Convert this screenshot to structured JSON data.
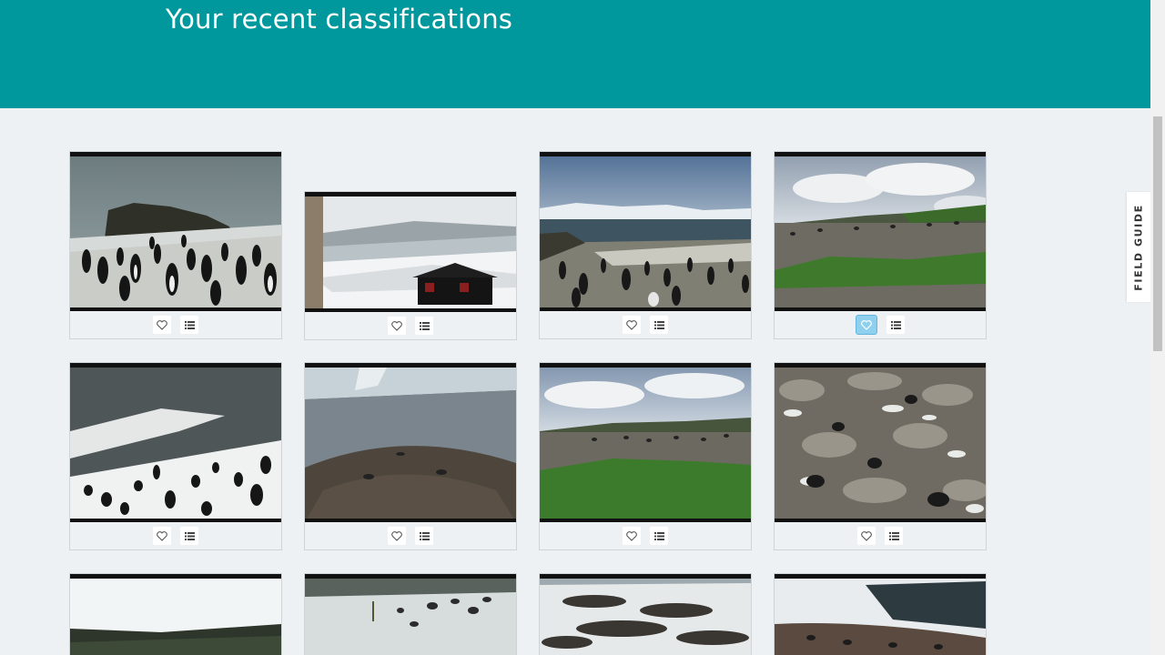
{
  "header": {
    "title": "Your recent classifications",
    "background_color": "#00979d"
  },
  "sidebar_tab": {
    "label": "FIELD GUIDE"
  },
  "icons": {
    "favorite": "heart-icon",
    "collections": "list-icon"
  },
  "colors": {
    "page_background": "#eef1f4",
    "favorite_active": "#8fd0ee"
  },
  "classifications": [
    {
      "favorited": false,
      "scene": "colony-rock"
    },
    {
      "favorited": false,
      "scene": "hut-snow"
    },
    {
      "favorited": false,
      "scene": "colony-sea"
    },
    {
      "favorited": true,
      "scene": "grass-field"
    },
    {
      "favorited": false,
      "scene": "snow-penguins"
    },
    {
      "favorited": false,
      "scene": "rock-dome"
    },
    {
      "favorited": false,
      "scene": "grass-field-2"
    },
    {
      "favorited": false,
      "scene": "rocky-nests"
    },
    {
      "favorited": false,
      "scene": "bright-sky"
    },
    {
      "favorited": false,
      "scene": "snow-field"
    },
    {
      "favorited": false,
      "scene": "snow-colony"
    },
    {
      "favorited": false,
      "scene": "snow-water"
    }
  ]
}
